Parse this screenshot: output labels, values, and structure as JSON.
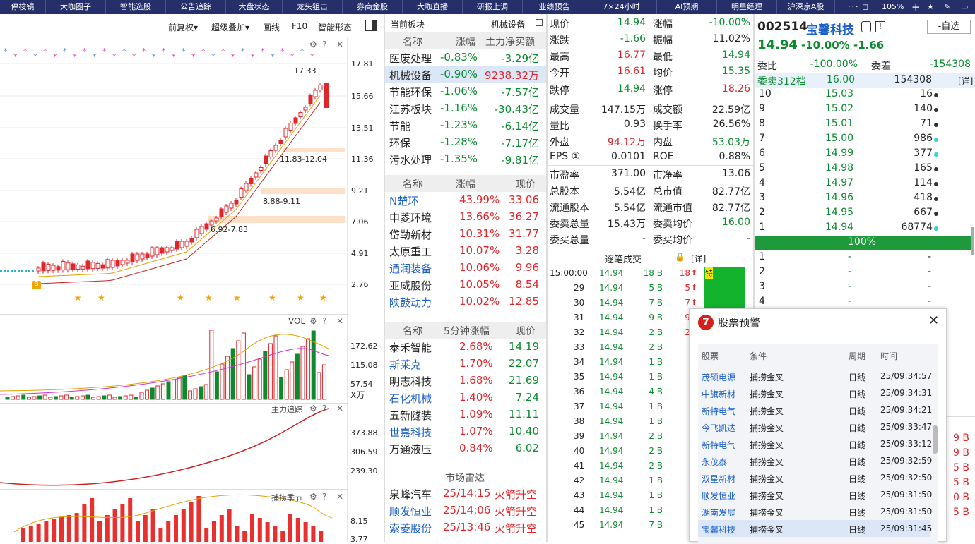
{
  "topnav": [
    "停梭镜",
    "大咖圈子",
    "智能选股",
    "公告追踪",
    "大盘状态",
    "龙头狙击",
    "券商金股",
    "大咖直播",
    "研报上调",
    "业绩预告",
    "7×24小时",
    "AI预期",
    "明星经理",
    "沪深京A股"
  ],
  "topright": {
    "zoom": "105%"
  },
  "chart_toolbar": {
    "adjust": "前复权▾",
    "overlay": "超级叠加▾",
    "draw": "画线",
    "f10": "F10",
    "smart": "智能形态"
  },
  "kline": {
    "prices": [
      "17.81",
      "15.66",
      "13.51",
      "11.36",
      "9.21",
      "7.06",
      "4.91",
      "2.76"
    ],
    "high_label": "17.33",
    "zones": [
      "11.83-12.04",
      "8.88-9.11",
      "6.92-7.83"
    ],
    "b_marker": "B"
  },
  "vol_panel": {
    "title": "VOL",
    "ticks": [
      "172.62",
      "115.08",
      "57.54"
    ],
    "unit": "X万"
  },
  "main_panel": {
    "title": "主力追踪",
    "ticks": [
      "373.88",
      "306.59",
      "239.30"
    ]
  },
  "capture_panel": {
    "title": "捕捞季节",
    "ticks": [
      "8.15",
      "3.77"
    ]
  },
  "sectors": {
    "header_left": "当前板块",
    "header_right": "机械设备",
    "cols": [
      "名称",
      "涨幅",
      "主力净买额"
    ],
    "rows": [
      [
        "医废处理",
        "-0.83%",
        "-3.29亿"
      ],
      [
        "机械设备",
        "-0.90%",
        "9238.32万"
      ],
      [
        "节能环保",
        "-1.06%",
        "-7.57亿"
      ],
      [
        "江苏板块",
        "-1.16%",
        "-30.43亿"
      ],
      [
        "节能",
        "-1.23%",
        "-6.14亿"
      ],
      [
        "环保",
        "-1.28%",
        "-7.17亿"
      ],
      [
        "污水处理",
        "-1.35%",
        "-9.81亿"
      ]
    ]
  },
  "gainers": {
    "cols": [
      "名称",
      "涨幅",
      "现价"
    ],
    "rows": [
      [
        "N楚环",
        "43.99%",
        "33.06"
      ],
      [
        "申菱环境",
        "13.66%",
        "36.27"
      ],
      [
        "岱勒新材",
        "10.31%",
        "31.77"
      ],
      [
        "太原重工",
        "10.07%",
        "3.28"
      ],
      [
        "通润装备",
        "10.06%",
        "9.96"
      ],
      [
        "亚威股份",
        "10.05%",
        "8.54"
      ],
      [
        "陕鼓动力",
        "10.02%",
        "12.85"
      ]
    ]
  },
  "fast5": {
    "cols": [
      "名称",
      "5分钟涨幅",
      "现价"
    ],
    "rows": [
      [
        "泰禾智能",
        "2.68%",
        "14.19"
      ],
      [
        "斯莱克",
        "1.70%",
        "22.07"
      ],
      [
        "明志科技",
        "1.68%",
        "21.69"
      ],
      [
        "石化机械",
        "1.40%",
        "7.24"
      ],
      [
        "五新隧装",
        "1.09%",
        "11.11"
      ],
      [
        "世嘉科技",
        "1.07%",
        "10.40"
      ],
      [
        "万通液压",
        "0.84%",
        "6.02"
      ]
    ]
  },
  "radar": {
    "title": "市场雷达",
    "rows": [
      [
        "泉峰汽车",
        "25/14:15",
        "火箭升空"
      ],
      [
        "顺发恒业",
        "25/14:06",
        "火箭升空"
      ],
      [
        "索菱股份",
        "25/13:46",
        "火箭升空"
      ]
    ]
  },
  "quote": {
    "code": "002514",
    "name": "宝馨科技",
    "price": "14.94",
    "pct": "-10.00%",
    "chg": "-1.66",
    "watch": "-自选",
    "left": [
      [
        "现价",
        "14.94"
      ],
      [
        "涨跌",
        "-1.66"
      ],
      [
        "最高",
        "16.77"
      ],
      [
        "今开",
        "16.61"
      ],
      [
        "跌停",
        "14.94"
      ],
      [
        "成交量",
        "147.15万"
      ],
      [
        "量比",
        "0.93"
      ],
      [
        "外盘",
        "94.12万"
      ],
      [
        "EPS ①",
        "0.0101"
      ],
      [
        "市盈率",
        "371.00"
      ],
      [
        "总股本",
        "5.54亿"
      ],
      [
        "流通股本",
        "5.54亿"
      ],
      [
        "委卖总量",
        "15.43万"
      ],
      [
        "委买总量",
        "-"
      ]
    ],
    "right": [
      [
        "涨幅",
        "-10.00%"
      ],
      [
        "振幅",
        "11.02%"
      ],
      [
        "最低",
        "14.94"
      ],
      [
        "均价",
        "15.35"
      ],
      [
        "涨停",
        "18.26"
      ],
      [
        "成交额",
        "22.59亿"
      ],
      [
        "换手率",
        "26.56%"
      ],
      [
        "内盘",
        "53.03万"
      ],
      [
        "ROE",
        "0.88%"
      ],
      [
        "市净率",
        "13.06"
      ],
      [
        "总市值",
        "82.77亿"
      ],
      [
        "流通市值",
        "82.77亿"
      ],
      [
        "委卖均价",
        "16.00"
      ],
      [
        "委买均价",
        "-"
      ]
    ]
  },
  "orderbook": {
    "weibi_lbl": "委比",
    "weibi": "-100.00%",
    "weicha_lbl": "委差",
    "weicha": "-154308",
    "sell312": "委卖312档",
    "sell312_price": "16.00",
    "sell312_vol": "154308",
    "detail": "[详]",
    "asks": [
      [
        "10",
        "15.03",
        "16"
      ],
      [
        "9",
        "15.02",
        "140"
      ],
      [
        "8",
        "15.01",
        "71"
      ],
      [
        "7",
        "15.00",
        "986"
      ],
      [
        "6",
        "14.99",
        "377"
      ],
      [
        "5",
        "14.98",
        "165"
      ],
      [
        "4",
        "14.97",
        "114"
      ],
      [
        "3",
        "14.96",
        "418"
      ],
      [
        "2",
        "14.95",
        "667"
      ],
      [
        "1",
        "14.94",
        "68774"
      ]
    ],
    "pct": "100%",
    "bids": [
      [
        "1",
        "-",
        "-"
      ],
      [
        "2",
        "-",
        "-"
      ],
      [
        "3",
        "-",
        "-"
      ],
      [
        "4",
        "-",
        "-"
      ]
    ]
  },
  "ticks": {
    "title": "逐笔成交",
    "detail": "[详]",
    "special": "特",
    "rows": [
      [
        "15:00:00",
        "14.94",
        "18 B",
        "18"
      ],
      [
        "29",
        "14.94",
        "5 B",
        "5"
      ],
      [
        "30",
        "14.94",
        "7 B",
        "7"
      ],
      [
        "31",
        "14.94",
        "9 B",
        "9"
      ],
      [
        "32",
        "14.94",
        "2 B",
        "2"
      ],
      [
        "33",
        "14.94",
        "2 B",
        ""
      ],
      [
        "34",
        "14.94",
        "1 B",
        ""
      ],
      [
        "35",
        "14.94",
        "1 B",
        ""
      ],
      [
        "36",
        "14.94",
        "4 B",
        ""
      ],
      [
        "37",
        "14.94",
        "1 B",
        ""
      ],
      [
        "38",
        "14.94",
        "1 B",
        ""
      ],
      [
        "39",
        "14.94",
        "2 B",
        ""
      ],
      [
        "40",
        "14.94",
        "2 B",
        ""
      ],
      [
        "41",
        "14.94",
        "2 B",
        ""
      ],
      [
        "42",
        "14.94",
        "1 B",
        ""
      ],
      [
        "43",
        "14.94",
        "1 B",
        ""
      ],
      [
        "44",
        "14.94",
        "1 B",
        ""
      ],
      [
        "45",
        "14.94",
        "7 B",
        ""
      ]
    ]
  },
  "alert": {
    "title": "股票预警",
    "cols": [
      "股票",
      "条件",
      "周期",
      "时间"
    ],
    "rows": [
      [
        "茂硕电源",
        "捕捞金叉",
        "日线",
        "25/09:34:57"
      ],
      [
        "中旗新材",
        "捕捞金叉",
        "日线",
        "25/09:34:31"
      ],
      [
        "新特电气",
        "捕捞金叉",
        "日线",
        "25/09:34:21"
      ],
      [
        "今飞凯达",
        "捕捞金叉",
        "日线",
        "25/09:33:47"
      ],
      [
        "新特电气",
        "捕捞金叉",
        "日线",
        "25/09:33:12"
      ],
      [
        "永茂泰",
        "捕捞金叉",
        "日线",
        "25/09:32:59"
      ],
      [
        "双星新材",
        "捕捞金叉",
        "日线",
        "25/09:32:50"
      ],
      [
        "顺发恒业",
        "捕捞金叉",
        "日线",
        "25/09:31:50"
      ],
      [
        "湖南发展",
        "捕捞金叉",
        "日线",
        "25/09:31:50"
      ],
      [
        "宝馨科技",
        "捕捞金叉",
        "日线",
        "25/09:31:45"
      ]
    ]
  },
  "edge_b": [
    "9 B",
    "9 B",
    "5 B",
    "5 B",
    "0 B",
    "5 B"
  ]
}
